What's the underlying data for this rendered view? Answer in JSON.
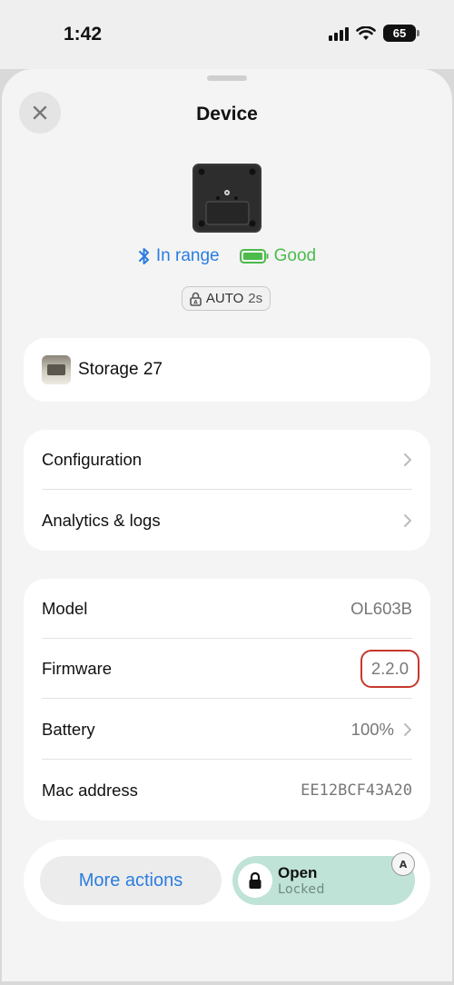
{
  "status_bar": {
    "time": "1:42",
    "battery": "65"
  },
  "header": {
    "title": "Device"
  },
  "status": {
    "connection": "In range",
    "battery_status": "Good",
    "auto_label": "AUTO",
    "auto_delay": "2s"
  },
  "storage": {
    "name": "Storage 27"
  },
  "nav_items": [
    {
      "label": "Configuration"
    },
    {
      "label": "Analytics & logs"
    }
  ],
  "info": {
    "model_label": "Model",
    "model_value": "OL603B",
    "firmware_label": "Firmware",
    "firmware_value": "2.2.0",
    "battery_label": "Battery",
    "battery_value": "100%",
    "mac_label": "Mac address",
    "mac_value": "EE12BCF43A20"
  },
  "actions": {
    "more_label": "More actions",
    "open_label": "Open",
    "open_sub": "Locked"
  },
  "colors": {
    "accent_blue": "#2a7de0",
    "good_green": "#4cbb4c",
    "open_bg": "#bfe3d6",
    "highlight_red": "#c6382d"
  },
  "icons": [
    "bluetooth-icon",
    "battery-icon",
    "lock-icon",
    "close-icon",
    "chevron-right-icon",
    "auto-lock-icon"
  ]
}
